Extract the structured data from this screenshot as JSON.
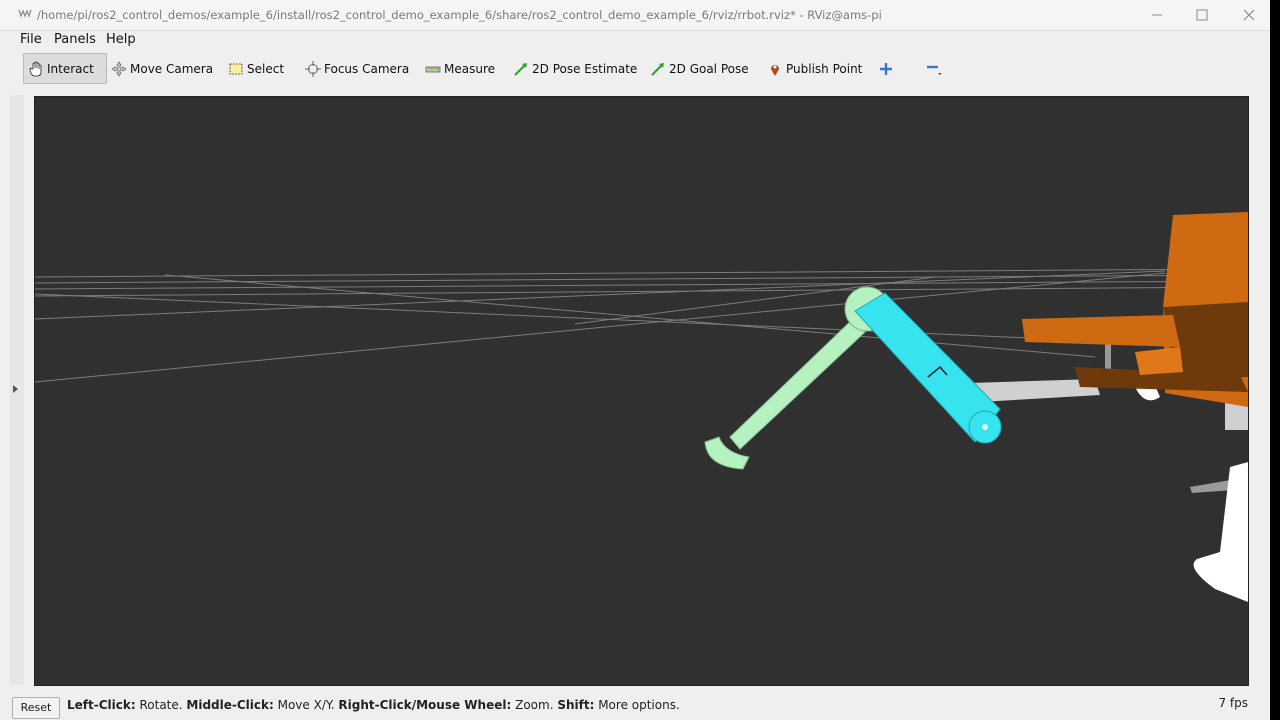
{
  "window": {
    "title": "/home/pi/ros2_control_demos/example_6/install/ros2_control_demo_example_6/share/ros2_control_demo_example_6/rviz/rrbot.rviz* - RViz@ams-pi"
  },
  "menu": {
    "file": "File",
    "panels": "Panels",
    "help": "Help"
  },
  "toolbar": {
    "interact": "Interact",
    "move_camera": "Move Camera",
    "select": "Select",
    "focus_camera": "Focus Camera",
    "measure": "Measure",
    "pose_estimate": "2D Pose Estimate",
    "goal_pose": "2D Goal Pose",
    "publish_point": "Publish Point"
  },
  "status": {
    "reset": "Reset",
    "left_click_key": "Left-Click:",
    "left_click_val": " Rotate. ",
    "middle_click_key": "Middle-Click:",
    "middle_click_val": " Move X/Y. ",
    "right_click_key": "Right-Click/Mouse Wheel:",
    "right_click_val": " Zoom. ",
    "shift_key": "Shift:",
    "shift_val": " More options.",
    "fps": "7 fps"
  },
  "colors": {
    "viewport_bg": "#303030",
    "link_green": "#b6f2c0",
    "link_cyan": "#37e3ef",
    "robot_orange": "#cf6a12",
    "robot_brown": "#6e3a0c"
  },
  "icons": [
    "rviz-app-icon",
    "minimize-icon",
    "maximize-icon",
    "close-icon",
    "hand-icon",
    "move-camera-icon",
    "select-icon",
    "focus-camera-icon",
    "measure-icon",
    "pose-estimate-arrow-icon",
    "goal-pose-arrow-icon",
    "map-pin-icon",
    "plus-icon",
    "minus-icon"
  ]
}
